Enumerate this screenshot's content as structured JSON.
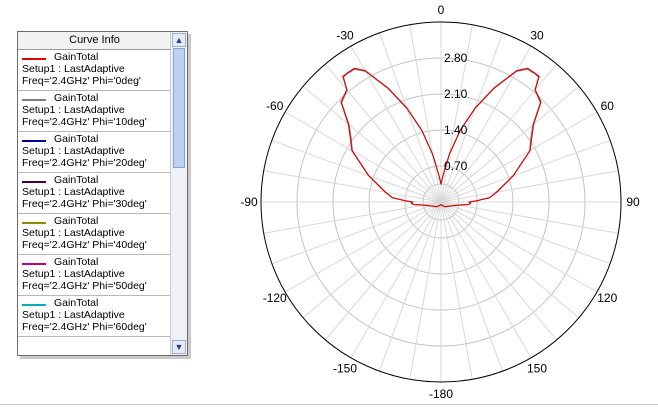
{
  "curve_info": {
    "title": "Curve Info",
    "entries": [
      {
        "name": "GainTotal",
        "setup": "Setup1 : LastAdaptive",
        "freq": "Freq='2.4GHz' Phi='0deg'",
        "color": "#e00000"
      },
      {
        "name": "GainTotal",
        "setup": "Setup1 : LastAdaptive",
        "freq": "Freq='2.4GHz' Phi='10deg'",
        "color": "#7f7f7f"
      },
      {
        "name": "GainTotal",
        "setup": "Setup1 : LastAdaptive",
        "freq": "Freq='2.4GHz' Phi='20deg'",
        "color": "#0000a0"
      },
      {
        "name": "GainTotal",
        "setup": "Setup1 : LastAdaptive",
        "freq": "Freq='2.4GHz' Phi='30deg'",
        "color": "#400040"
      },
      {
        "name": "GainTotal",
        "setup": "Setup1 : LastAdaptive",
        "freq": "Freq='2.4GHz' Phi='40deg'",
        "color": "#8c8c00"
      },
      {
        "name": "GainTotal",
        "setup": "Setup1 : LastAdaptive",
        "freq": "Freq='2.4GHz' Phi='50deg'",
        "color": "#c0007f"
      },
      {
        "name": "GainTotal",
        "setup": "Setup1 : LastAdaptive",
        "freq": "Freq='2.4GHz' Phi='60deg'",
        "color": "#00b0c0"
      }
    ]
  },
  "chart_data": {
    "type": "polar",
    "title": "",
    "radial_ticks": [
      "0.70",
      "1.40",
      "2.10",
      "2.80"
    ],
    "rlim": [
      0,
      3.5
    ],
    "angle_ticks": [
      {
        "deg": 0,
        "label": "0"
      },
      {
        "deg": 30,
        "label": "30"
      },
      {
        "deg": 60,
        "label": "60"
      },
      {
        "deg": 90,
        "label": "90"
      },
      {
        "deg": 120,
        "label": "120"
      },
      {
        "deg": 150,
        "label": "150"
      },
      {
        "deg": 180,
        "label": "-180"
      },
      {
        "deg": -150,
        "label": "-150"
      },
      {
        "deg": -120,
        "label": "-120"
      },
      {
        "deg": -90,
        "label": "-90"
      },
      {
        "deg": -60,
        "label": "-60"
      },
      {
        "deg": -30,
        "label": "-30"
      }
    ],
    "grid": true,
    "series": [
      {
        "name": "GainTotal",
        "color": "#e00000",
        "theta": [
          0,
          4,
          8,
          10,
          15,
          20,
          25,
          30,
          33,
          35,
          36,
          38,
          40,
          45,
          50,
          55,
          60,
          70,
          80,
          85,
          88,
          90,
          92,
          95,
          100,
          140,
          170,
          180,
          -170,
          -140,
          -100,
          -95,
          -92,
          -90,
          -88,
          -85,
          -80,
          -70,
          -60,
          -55,
          -50,
          -45,
          -40,
          -38,
          -36,
          -35,
          -33,
          -30,
          -25,
          -20,
          -15,
          -10,
          -8,
          -4
        ],
        "r": [
          0.35,
          0.5,
          0.75,
          0.95,
          1.45,
          1.95,
          2.45,
          2.95,
          3.1,
          3.1,
          3.1,
          3.1,
          2.85,
          2.75,
          2.35,
          2.15,
          2.0,
          1.5,
          1.1,
          0.95,
          0.7,
          0.55,
          0.58,
          0.55,
          0.35,
          0.12,
          0.06,
          0.05,
          0.06,
          0.12,
          0.35,
          0.55,
          0.58,
          0.55,
          0.7,
          0.95,
          1.1,
          1.5,
          2.0,
          2.15,
          2.35,
          2.75,
          2.85,
          3.1,
          3.1,
          3.1,
          3.1,
          2.95,
          2.45,
          1.95,
          1.45,
          0.95,
          0.75,
          0.5
        ]
      },
      {
        "name": "GainTotal",
        "color": "#7f7f7f",
        "theta": [
          0,
          4,
          8,
          10,
          15,
          20,
          25,
          30,
          33,
          35,
          36,
          38,
          40,
          45,
          50,
          55,
          60,
          70,
          80,
          85,
          88,
          90,
          92,
          95,
          100,
          140,
          170,
          180,
          -170,
          -140,
          -100,
          -95,
          -92,
          -90,
          -88,
          -85,
          -80,
          -70,
          -60,
          -55,
          -50,
          -45,
          -40,
          -38,
          -36,
          -35,
          -33,
          -30,
          -25,
          -20,
          -15,
          -10,
          -8,
          -4
        ],
        "r": [
          0.34,
          0.49,
          0.74,
          0.94,
          1.43,
          1.93,
          2.43,
          2.93,
          3.08,
          3.08,
          3.09,
          3.08,
          2.84,
          2.73,
          2.33,
          2.13,
          1.99,
          1.49,
          1.09,
          0.94,
          0.69,
          0.54,
          0.57,
          0.54,
          0.34,
          0.12,
          0.06,
          0.05,
          0.06,
          0.12,
          0.34,
          0.54,
          0.57,
          0.54,
          0.69,
          0.94,
          1.09,
          1.49,
          1.99,
          2.13,
          2.33,
          2.73,
          2.84,
          3.08,
          3.09,
          3.08,
          3.08,
          2.93,
          2.43,
          1.93,
          1.43,
          0.94,
          0.74,
          0.49
        ]
      }
    ]
  }
}
